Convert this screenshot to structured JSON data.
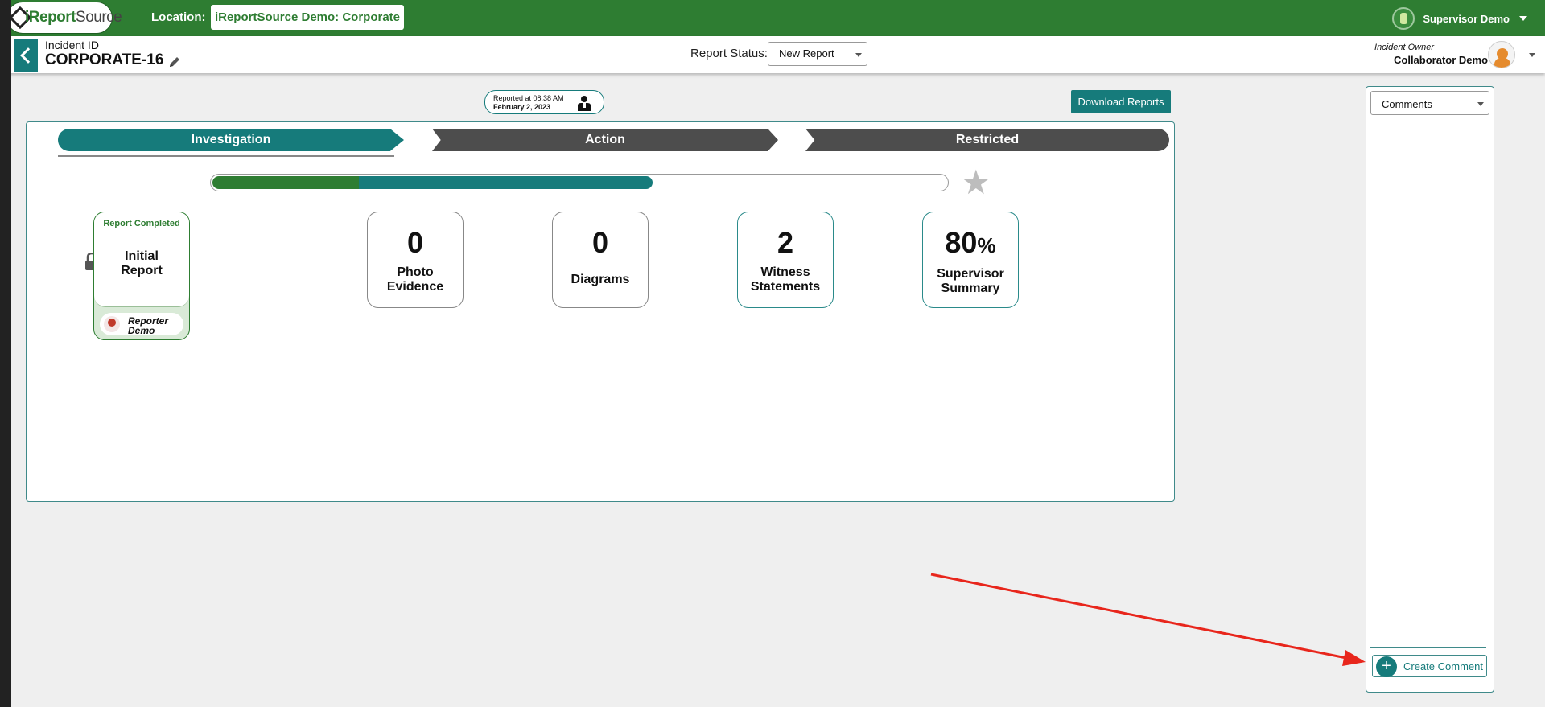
{
  "topbar": {
    "logo_text_1": "i",
    "logo_text_2": "Report",
    "logo_text_3": "Source",
    "location_label": "Location:",
    "location_value": "iReportSource Demo: Corporate",
    "user_name": "Supervisor Demo"
  },
  "subheader": {
    "incident_label": "Incident ID",
    "incident_id": "CORPORATE-16",
    "status_label": "Report Status:",
    "status_value": "New Report",
    "owner_label": "Incident Owner",
    "owner_name": "Collaborator Demo"
  },
  "reported": {
    "line1": "Reported at 08:38 AM",
    "line2": "February 2, 2023"
  },
  "download_label": "Download Reports",
  "steps": [
    "Investigation",
    "Action",
    "Restricted"
  ],
  "progress": {
    "green_fraction": 0.2,
    "teal_fraction": 0.6
  },
  "initial_report": {
    "status": "Report Completed",
    "title_line1": "Initial",
    "title_line2": "Report",
    "reporter_line1": "Reporter",
    "reporter_line2": "Demo"
  },
  "stats": [
    {
      "number": "0",
      "line1": "Photo",
      "line2": "Evidence"
    },
    {
      "number": "0",
      "line1": "Diagrams",
      "line2": ""
    },
    {
      "number": "2",
      "line1": "Witness",
      "line2": "Statements"
    },
    {
      "number": "80",
      "suffix": "%",
      "line1": "Supervisor",
      "line2": "Summary"
    }
  ],
  "comments": {
    "select_value": "Comments",
    "create_label": "Create Comment"
  },
  "colors": {
    "brand_green": "#2e7d32",
    "teal": "#167b7b",
    "dark_step": "#4d4d4d",
    "annotation_arrow": "#e8261c"
  }
}
